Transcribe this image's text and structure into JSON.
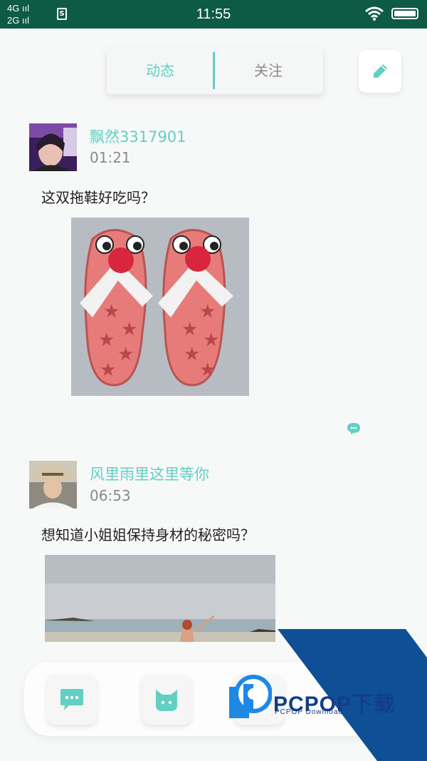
{
  "status_bar": {
    "signal_top": "4G",
    "signal_bottom": "2G",
    "sim_label": "S",
    "time": "11:55"
  },
  "tabs": [
    {
      "label": "动态",
      "active": true
    },
    {
      "label": "关注",
      "active": false
    }
  ],
  "edit_button": {
    "icon": "pencil-icon"
  },
  "posts": [
    {
      "username": "飘然3317901",
      "time": "01:21",
      "text": "这双拖鞋好吃吗？",
      "image_icon": "watermelon-slippers-photo"
    },
    {
      "username": "风里雨里这里等你",
      "time": "06:53",
      "text": "想知道小姐姐保持身材的秘密吗？",
      "image_icon": "beach-photo"
    }
  ],
  "bottom_nav": [
    {
      "icon": "chat-bubble-icon"
    },
    {
      "icon": "cat-face-icon"
    },
    {
      "icon": "nav-icon"
    }
  ],
  "watermark": {
    "brand": "PCPOP下载",
    "sub": "PCPOP Download"
  },
  "colors": {
    "accent": "#62cfc2",
    "status_bar": "#0d5a45",
    "watermark": "#0f4f96"
  }
}
